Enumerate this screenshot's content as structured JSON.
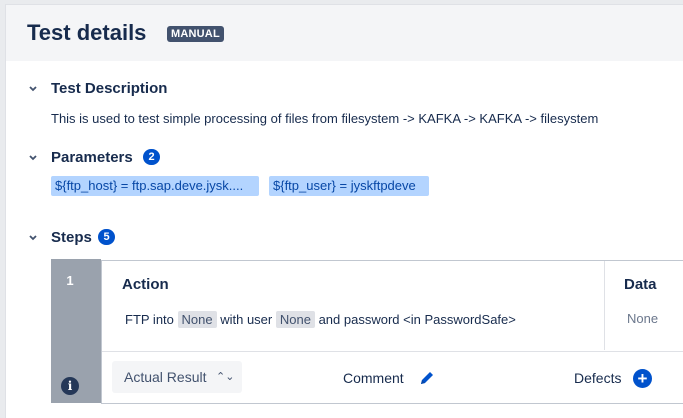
{
  "header": {
    "title": "Test details",
    "badge": "MANUAL"
  },
  "sections": {
    "description": {
      "title": "Test Description",
      "text": "This is used to test simple processing of files from filesystem -> KAFKA -> KAFKA -> filesystem"
    },
    "parameters": {
      "title": "Parameters",
      "count": "2",
      "items": [
        "${ftp_host} = ftp.sap.deve.jysk....",
        "${ftp_user} = jyskftpdeve"
      ]
    },
    "steps": {
      "title": "Steps",
      "count": "5"
    }
  },
  "step": {
    "number": "1",
    "info_icon": "i",
    "action_header": "Action",
    "action_parts": [
      "FTP into",
      "None",
      "with user",
      "None",
      "and password <in PasswordSafe>"
    ],
    "data_header": "Data",
    "data_value": "None",
    "result_label": "Actual Result",
    "comment_label": "Comment",
    "defects_label": "Defects",
    "add_symbol": "+"
  },
  "colors": {
    "accent": "#0052cc",
    "badge": "#42526e",
    "param_bg": "#b3d4ff"
  },
  "icons": [
    "chevron-down-icon",
    "info-icon",
    "pencil-icon",
    "add-circle-icon"
  ]
}
